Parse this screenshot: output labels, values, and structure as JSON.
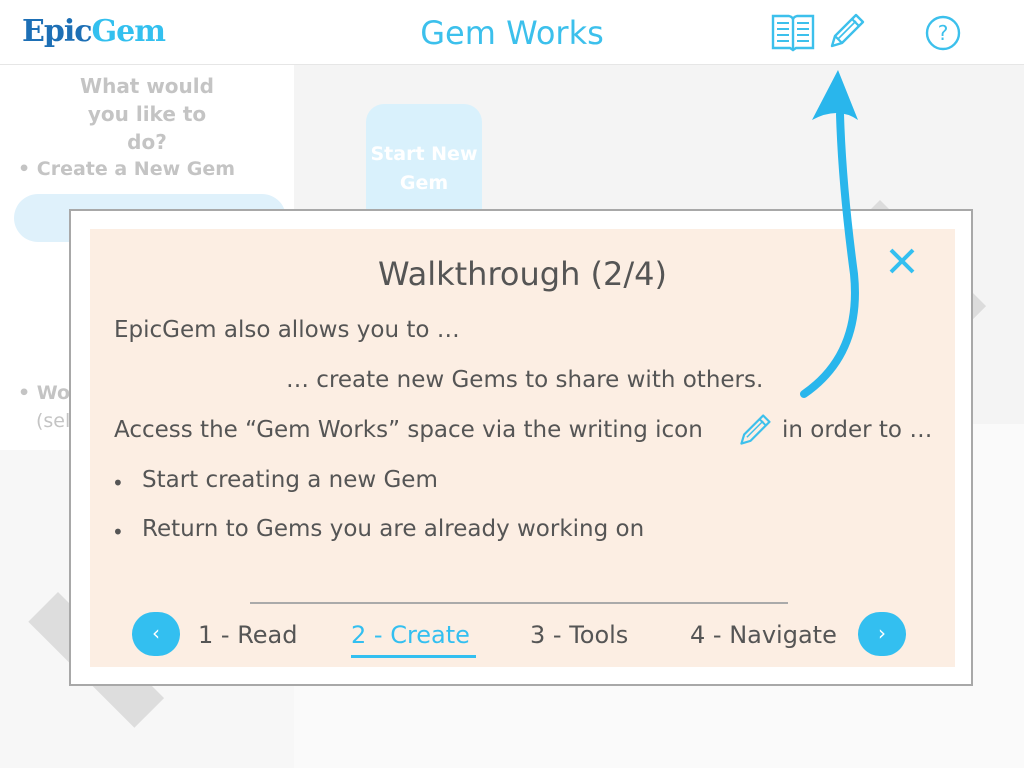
{
  "header": {
    "logo_part1": "Epic",
    "logo_part2": "Gem",
    "title": "Gem Works",
    "help_label": "?"
  },
  "sidebar": {
    "question": "What would you like to do?",
    "items": [
      "• Create a New Gem",
      "• Wo",
      "(sel"
    ]
  },
  "main": {
    "start_card_label": "Start New Gem"
  },
  "modal": {
    "title": "Walkthrough (2/4)",
    "close_label": "✕",
    "lines": {
      "intro": "EpicGem also allows you to …",
      "share": "… create new Gems to share with others.",
      "access_before": "Access the “Gem Works” space via the writing icon",
      "access_after": "in order to …"
    },
    "bullets": [
      "Start creating a new Gem",
      "Return to Gems you are already working on"
    ],
    "nav": {
      "prev_label": "‹",
      "next_label": "›",
      "steps": [
        "1 - Read",
        "2 - Create",
        "3 - Tools",
        "4 - Navigate"
      ],
      "active_index": 1
    }
  },
  "colors": {
    "accent": "#33bff0",
    "logo_dark": "#1d6fb5",
    "modal_bg": "#fceee3",
    "text": "#555555"
  }
}
